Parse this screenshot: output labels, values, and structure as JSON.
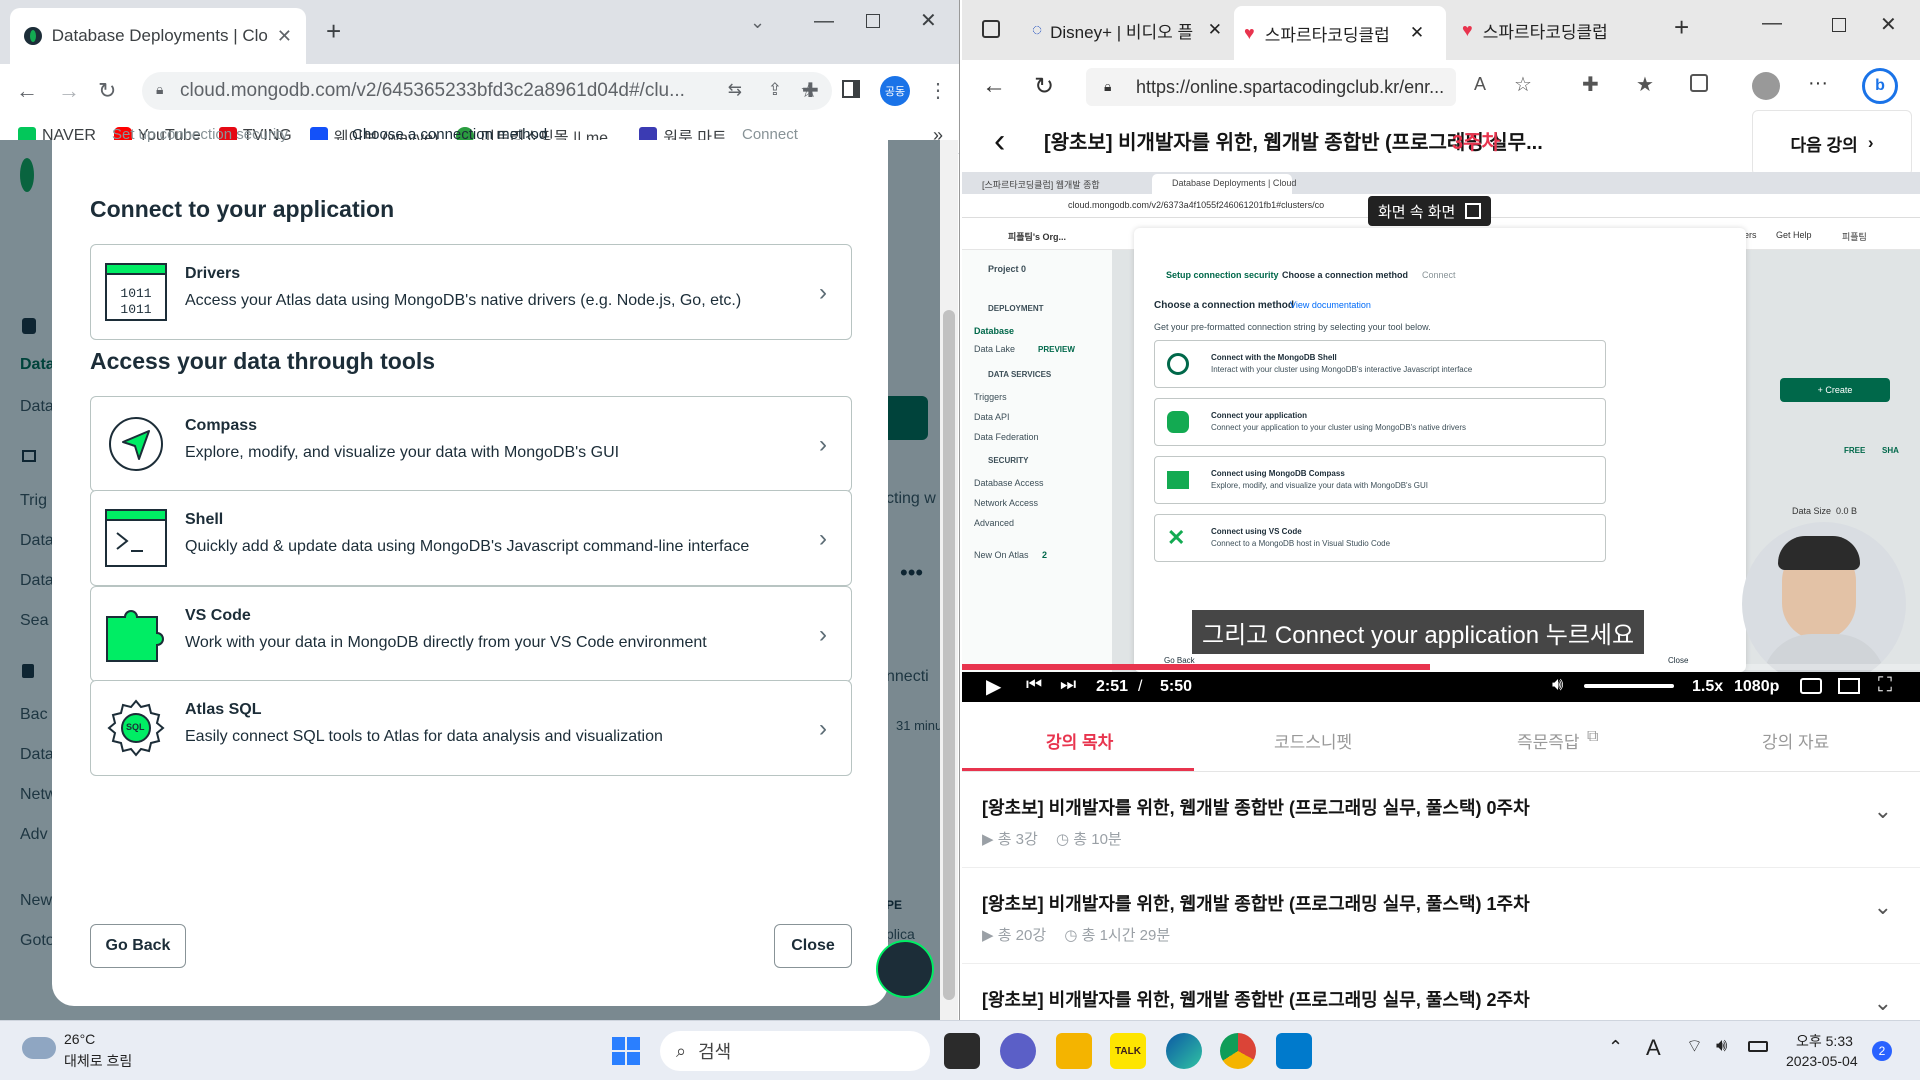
{
  "left_window": {
    "tab_title": "Database Deployments | Cloud:",
    "url": "cloud.mongodb.com/v2/645365233bfd3c2a8961d04d#/clu...",
    "profile_badge": "공동",
    "bookmarks": [
      {
        "label": "NAVER",
        "color": "#03c75a"
      },
      {
        "label": "YouTube",
        "color": "#ff0000"
      },
      {
        "label": "TVING",
        "color": "#e50914"
      },
      {
        "label": "웨이브 (wavve)",
        "color": "#1351f9"
      },
      {
        "label": "미트리쇼핑몰 || me...",
        "color": "#2a9d3f"
      },
      {
        "label": "원룸 마트",
        "color": "#3b3bb3"
      }
    ]
  },
  "behind": {
    "left_items": [
      "Data",
      "Data",
      "Trig",
      "Data",
      "Data",
      "Sea",
      "Bac",
      "Data",
      "Netw",
      "Adv",
      "New",
      "Goto"
    ],
    "right_snippets": [
      "cting w",
      "nnecti",
      "31 minu",
      "PE",
      "plica"
    ]
  },
  "modal": {
    "stepper_partial": [
      "Set up connection security",
      "Choose a connection method",
      "Connect"
    ],
    "section1_title": "Connect to your application",
    "section2_title": "Access your data through tools",
    "drivers": {
      "title": "Drivers",
      "desc": "Access your Atlas data using MongoDB's native drivers (e.g. Node.js, Go, etc.)"
    },
    "compass": {
      "title": "Compass",
      "desc": "Explore, modify, and visualize your data with MongoDB's GUI"
    },
    "shell": {
      "title": "Shell",
      "desc": "Quickly add & update data using MongoDB's Javascript command-line interface"
    },
    "vscode": {
      "title": "VS Code",
      "desc": "Work with your data in MongoDB directly from your VS Code environment"
    },
    "atlas_sql": {
      "title": "Atlas SQL",
      "desc": "Easily connect SQL tools to Atlas for data analysis and visualization"
    },
    "go_back": "Go Back",
    "close": "Close",
    "sql_badge": "SQL"
  },
  "right_window": {
    "tabs": [
      "Disney+ | 비디오 플",
      "스파르타코딩클럽",
      "스파르타코딩클럽"
    ],
    "url": "https://online.spartacodingclub.kr/enr...",
    "lecture_title": "[왕초보] 비개발자를 위한, 웹개발 종합반 (프로그래밍 실무...",
    "week_badge": "3주차",
    "next_lecture": "다음 강의",
    "pip_label": "화면 속 화면",
    "subtitle": "그리고 Connect your application 누르세요",
    "time_current": "2:51",
    "time_sep": "/",
    "time_total": "5:50",
    "speed": "1.5x",
    "quality": "1080p",
    "progress": 0.489,
    "tabs_below": [
      "강의 목차",
      "코드스니펫",
      "즉문즉답",
      "강의 자료"
    ],
    "weeks": [
      {
        "title": "[왕초보] 비개발자를 위한, 웹개발 종합반 (프로그래밍 실무, 풀스택) 0주차",
        "lessons": "총 3강",
        "duration": "총 10분"
      },
      {
        "title": "[왕초보] 비개발자를 위한, 웹개발 종합반 (프로그래밍 실무, 풀스택) 1주차",
        "lessons": "총 20강",
        "duration": "총 1시간 29분"
      },
      {
        "title": "[왕초보] 비개발자를 위한, 웹개발 종합반 (프로그래밍 실무, 풀스택) 2주차",
        "lessons": "",
        "duration": ""
      }
    ],
    "inner_video": {
      "tab1": "[스파르타코딩클럽] 웹개발 종합",
      "tab2": "Database Deployments | Cloud",
      "url": "cloud.mongodb.com/v2/6373a4f1055f246061201fb1#clusters/co",
      "org": "피플팀's Org...",
      "project": "Project 0",
      "nav": [
        "DEPLOYMENT",
        "Database",
        "Data Lake",
        "PREVIEW",
        "DATA SERVICES",
        "Triggers",
        "Data API",
        "Data Federation",
        "SECURITY",
        "Database Access",
        "Network Access",
        "Advanced",
        "New On Atlas"
      ],
      "new_on_atlas_count": "2",
      "steps": [
        "Setup connection security",
        "Choose a connection method",
        "Connect"
      ],
      "heading": "Choose a connection method",
      "doc_link": "View documentation",
      "sub": "Get your pre-formatted connection string by selecting your tool below.",
      "options": [
        {
          "title": "Connect with the MongoDB Shell",
          "desc": "Interact with your cluster using MongoDB's interactive Javascript interface"
        },
        {
          "title": "Connect your application",
          "desc": "Connect your application to your cluster using MongoDB's native drivers"
        },
        {
          "title": "Connect using MongoDB Compass",
          "desc": "Explore, modify, and visualize your data with MongoDB's GUI"
        },
        {
          "title": "Connect using VS Code",
          "desc": "Connect to a MongoDB host in Visual Studio Code"
        }
      ],
      "go_back": "Go Back",
      "close": "Close",
      "create": "+ Create",
      "free": "FREE",
      "sha": "SHA",
      "data_size": "Data Size  0.0 B",
      "get_help": "Get Help",
      "users": "usters",
      "team": "피플팀"
    }
  },
  "taskbar": {
    "temp": "26°C",
    "weather": "대체로 흐림",
    "search": "검색",
    "time": "오후 5:33",
    "date": "2023-05-04",
    "notif_count": "2",
    "talk": "TALK"
  }
}
